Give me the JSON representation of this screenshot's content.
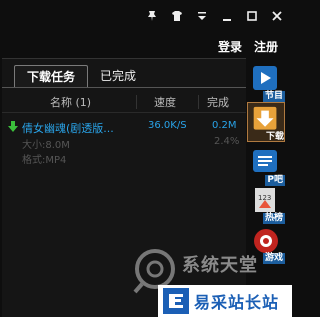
{
  "titlebar": {
    "icons": [
      "pin-icon",
      "shirt-icon",
      "menu-icon",
      "minimize-icon",
      "maximize-icon",
      "close-icon"
    ]
  },
  "auth": {
    "login": "登录",
    "register": "注册"
  },
  "tabs": [
    {
      "label": "下载任务",
      "active": true
    },
    {
      "label": "已完成",
      "active": false
    }
  ],
  "columns": {
    "name": "名称 (1)",
    "speed": "速度",
    "done": "完成"
  },
  "task": {
    "name": "倩女幽魂(剧透版...",
    "speed": "36.0K/S",
    "done": "0.2M",
    "size": "大小:8.0M",
    "percent": "2.4%",
    "format": "格式:MP4"
  },
  "sidebar": [
    {
      "label": "节目",
      "icon": "program-icon",
      "active": false
    },
    {
      "label": "下载",
      "icon": "download-icon",
      "active": true
    },
    {
      "label": "P吧",
      "icon": "forum-icon",
      "active": false
    },
    {
      "label": "热榜",
      "icon": "ranking-icon",
      "active": false
    },
    {
      "label": "游戏",
      "icon": "game-icon",
      "active": false
    }
  ],
  "watermark": {
    "text": "系统天堂"
  },
  "banner": {
    "text": "易采站长站"
  },
  "colors": {
    "accent": "#29a3e8",
    "background": "#0e0e0e",
    "sidebar_active": "#b07a40"
  }
}
